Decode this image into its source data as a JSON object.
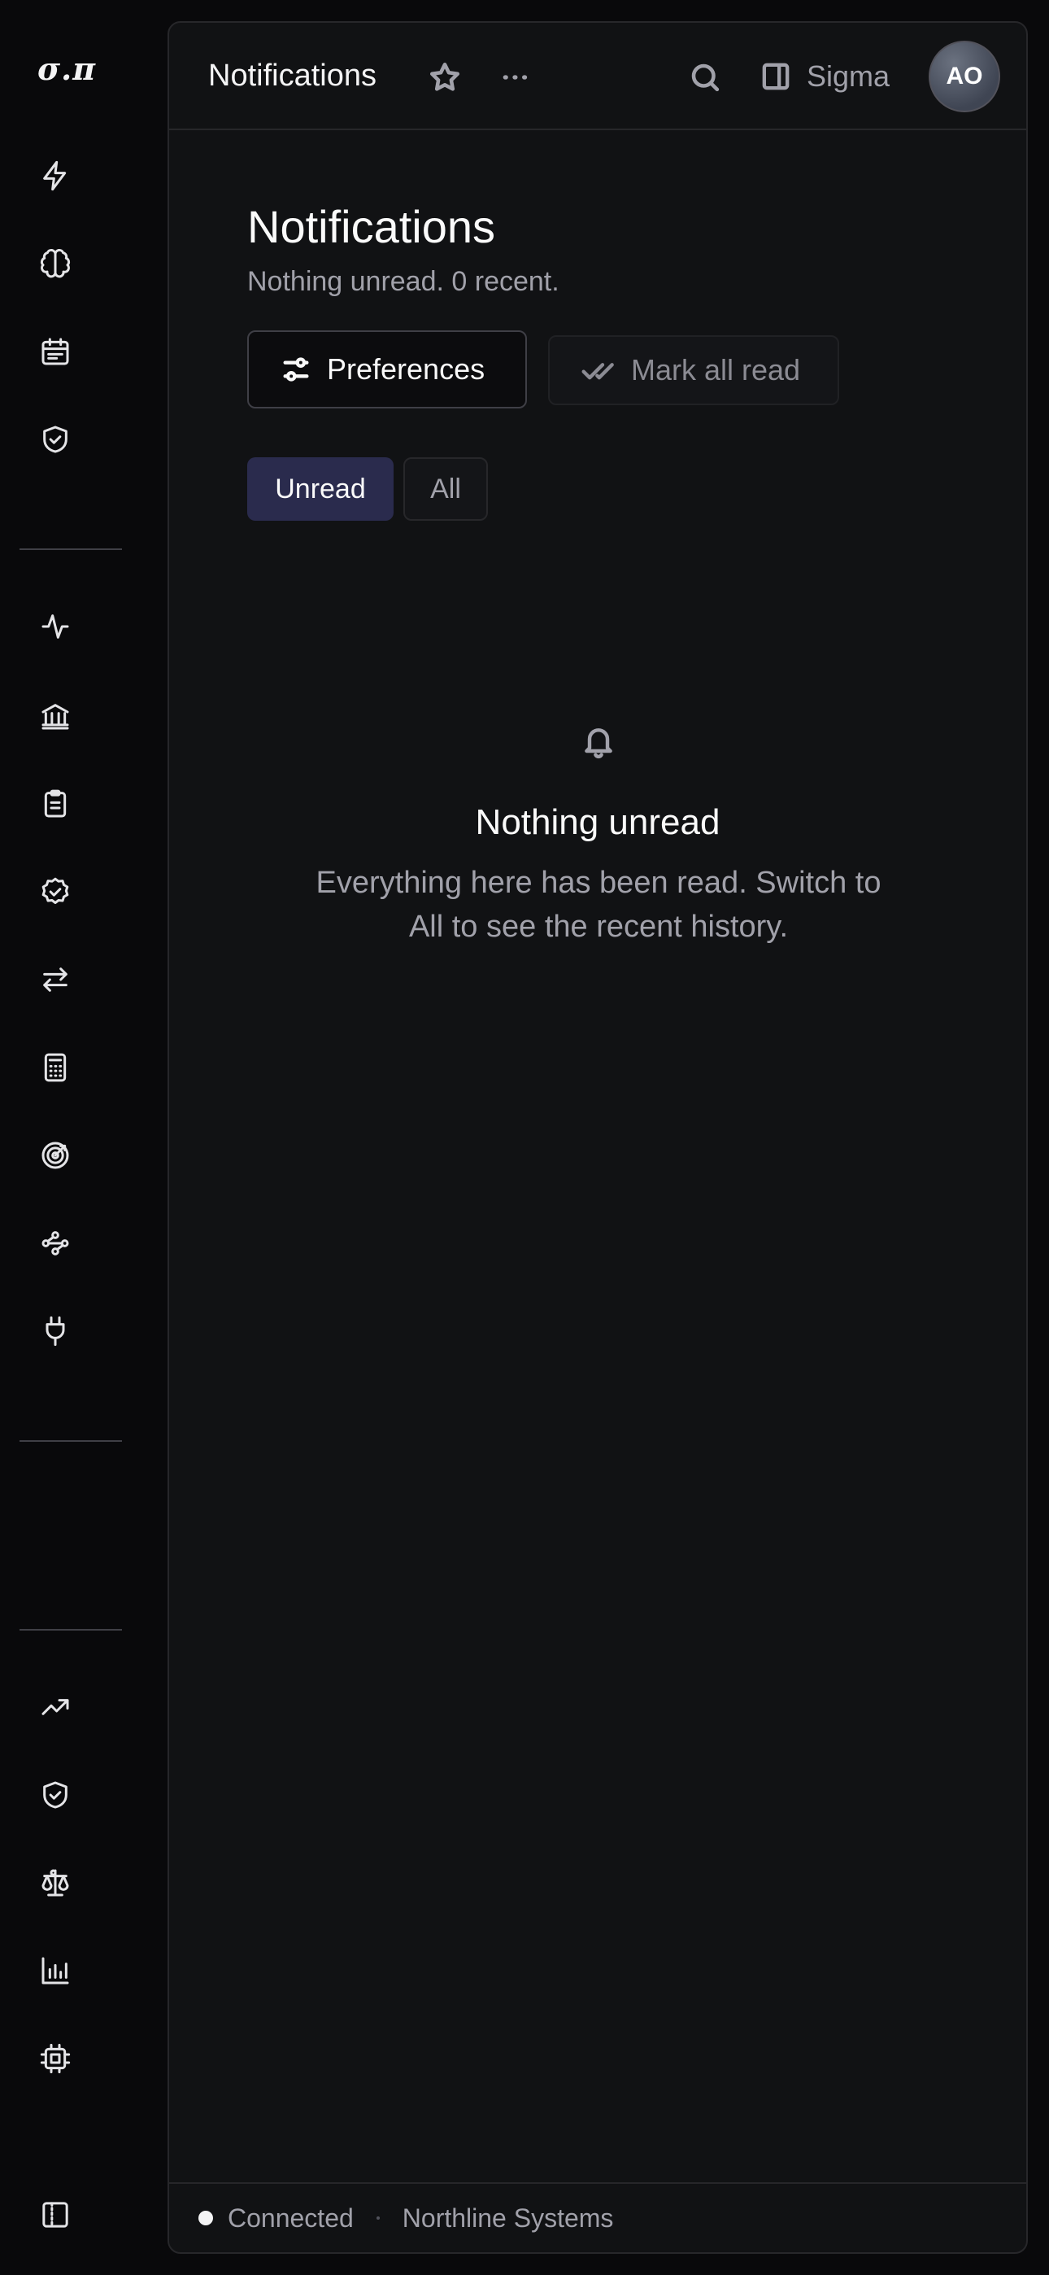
{
  "sidebar": {
    "logo": "σ.π",
    "group1": [
      "zap-icon",
      "brain-icon",
      "calendar-icon",
      "shield-check-icon"
    ],
    "group2": [
      "activity-icon",
      "bank-icon",
      "clipboard-icon",
      "badge-check-icon",
      "arrows-left-right-icon",
      "calculator-icon",
      "target-icon",
      "workflow-icon",
      "plug-icon"
    ],
    "group3": [
      "trending-up-icon",
      "shield-check-icon",
      "scale-icon",
      "bar-chart-icon",
      "cpu-icon"
    ],
    "bottom": [
      "panel-left-icon"
    ]
  },
  "topbar": {
    "title": "Notifications",
    "workspace_name": "Sigma",
    "avatar_initials": "AO"
  },
  "main": {
    "title": "Notifications",
    "subtitle": "Nothing unread. 0 recent.",
    "preferences_label": "Preferences",
    "mark_all_read_label": "Mark all read",
    "tabs": [
      {
        "label": "Unread",
        "active": true
      },
      {
        "label": "All",
        "active": false
      }
    ],
    "empty_title": "Nothing unread",
    "empty_description": "Everything here has been read. Switch to All to see the recent history."
  },
  "footer": {
    "status": "Connected",
    "organization": "Northline Systems"
  },
  "colors": {
    "background": "#09090b",
    "panel": "#111214",
    "active_tab": "#2a2b4d",
    "text_muted": "#a1a1aa"
  }
}
